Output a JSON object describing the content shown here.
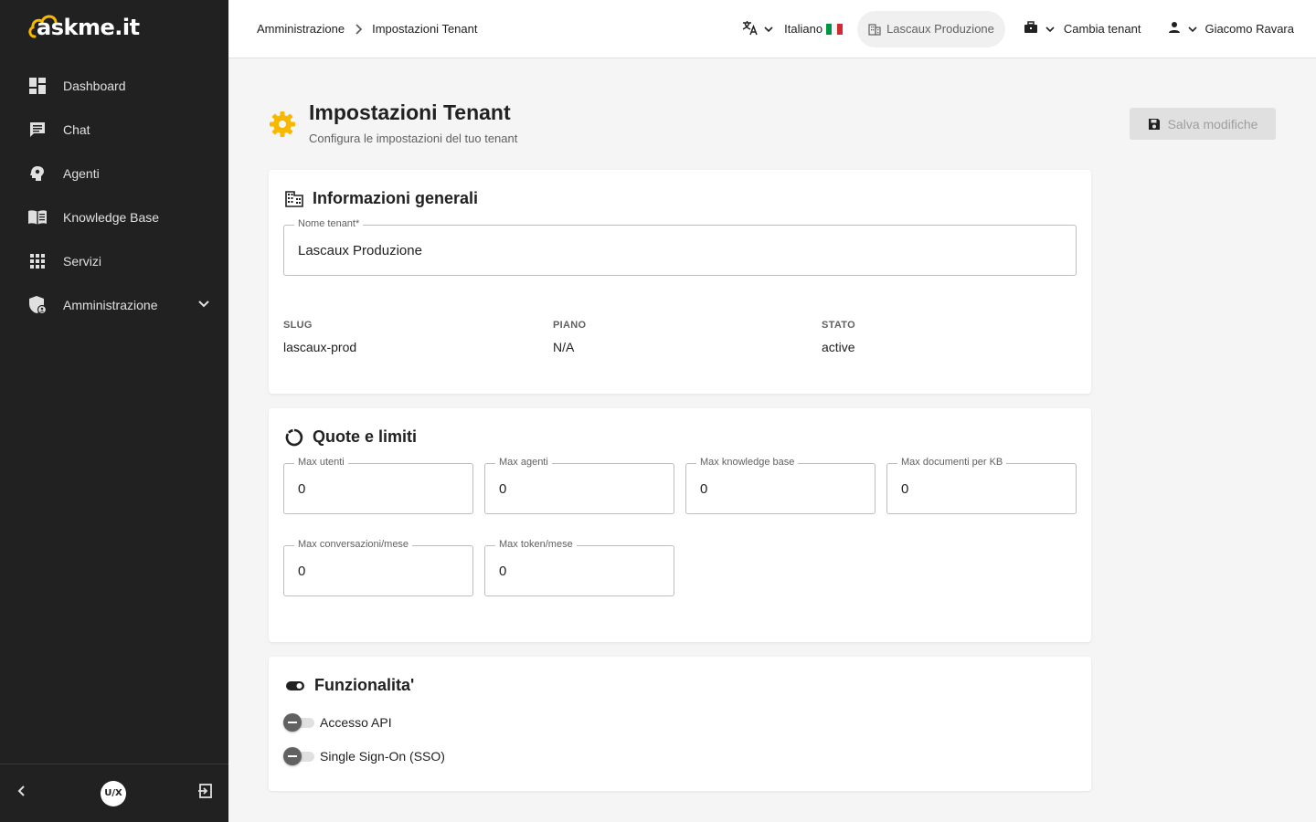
{
  "brand": {
    "name": "askme.it"
  },
  "sidebar": {
    "items": [
      {
        "label": "Dashboard",
        "icon": "dashboard-icon"
      },
      {
        "label": "Chat",
        "icon": "chat-icon"
      },
      {
        "label": "Agenti",
        "icon": "agent-icon"
      },
      {
        "label": "Knowledge Base",
        "icon": "book-icon"
      },
      {
        "label": "Servizi",
        "icon": "grid-icon"
      },
      {
        "label": "Amministrazione",
        "icon": "admin-shield-icon"
      }
    ],
    "footer_logo": "U/X"
  },
  "topbar": {
    "breadcrumb": [
      "Amministrazione",
      "Impostazioni Tenant"
    ],
    "language": "Italiano",
    "current_tenant": "Lascaux Produzione",
    "switch_tenant": "Cambia tenant",
    "user": "Giacomo Ravara"
  },
  "page": {
    "title": "Impostazioni Tenant",
    "subtitle": "Configura le impostazioni del tuo tenant",
    "save_label": "Salva modifiche"
  },
  "general": {
    "title": "Informazioni generali",
    "tenant_name_label": "Nome tenant*",
    "tenant_name_value": "Lascaux Produzione",
    "slug_label": "SLUG",
    "slug_value": "lascaux-prod",
    "plan_label": "PIANO",
    "plan_value": "N/A",
    "status_label": "STATO",
    "status_value": "active"
  },
  "quotas": {
    "title": "Quote e limiti",
    "fields": [
      {
        "label": "Max utenti",
        "value": "0"
      },
      {
        "label": "Max agenti",
        "value": "0"
      },
      {
        "label": "Max knowledge base",
        "value": "0"
      },
      {
        "label": "Max documenti per KB",
        "value": "0"
      },
      {
        "label": "Max conversazioni/mese",
        "value": "0"
      },
      {
        "label": "Max token/mese",
        "value": "0"
      }
    ]
  },
  "features": {
    "title": "Funzionalita'",
    "toggles": [
      {
        "label": "Accesso API",
        "enabled": false
      },
      {
        "label": "Single Sign-On (SSO)",
        "enabled": false
      }
    ]
  },
  "colors": {
    "sidebar_bg": "#212121",
    "accent_gear": "#f9b800",
    "flag_green": "#009246",
    "flag_white": "#ffffff",
    "flag_red": "#ce2b37"
  }
}
